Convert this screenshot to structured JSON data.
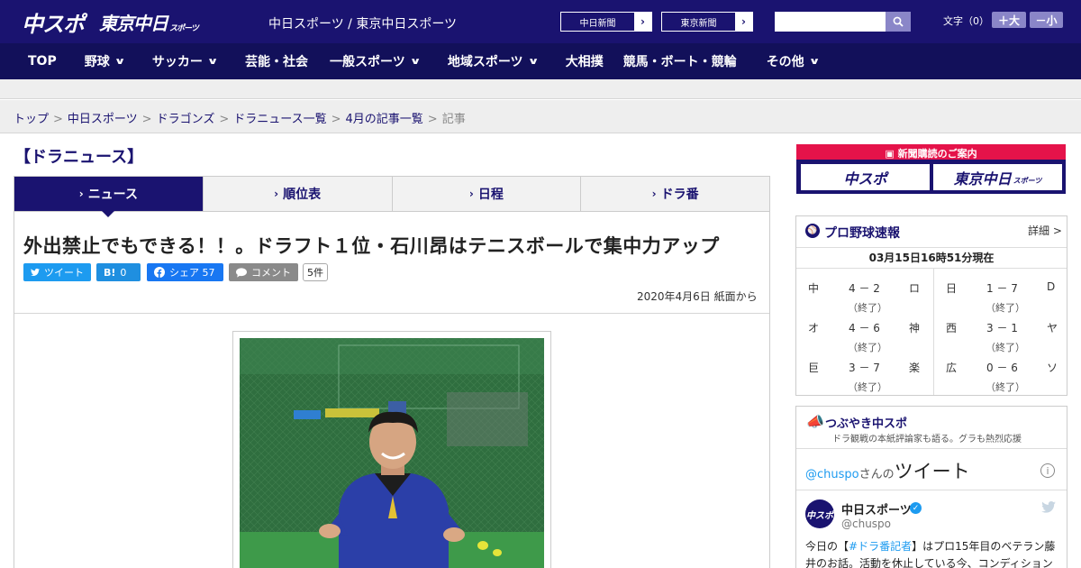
{
  "header": {
    "logo_chuspo": "中スポ",
    "logo_tokyo": "東京中日",
    "logo_tokyo_sub": "スポーツ",
    "site_title": "中日スポーツ / 東京中日スポーツ",
    "paper_links": [
      {
        "label": "中日新聞",
        "arrow": "›"
      },
      {
        "label": "東京新聞",
        "arrow": "›"
      }
    ],
    "search": {
      "placeholder": "",
      "icon": "search-icon"
    },
    "font_size_label": "文字（0）",
    "font_larger": "＋大",
    "font_smaller": "－小"
  },
  "nav": {
    "items": [
      {
        "label": "TOP",
        "dropdown": false
      },
      {
        "label": "野球",
        "dropdown": true
      },
      {
        "label": "サッカー",
        "dropdown": true
      },
      {
        "label": "芸能・社会",
        "dropdown": false
      },
      {
        "label": "一般スポーツ",
        "dropdown": true
      },
      {
        "label": "地域スポーツ",
        "dropdown": true
      },
      {
        "label": "大相撲",
        "dropdown": false
      },
      {
        "label": "競馬・ボート・競輪",
        "dropdown": false
      },
      {
        "label": "その他",
        "dropdown": true
      }
    ],
    "chevron": "∨"
  },
  "breadcrumb": {
    "items": [
      "トップ",
      "中日スポーツ",
      "ドラゴンズ",
      "ドラニュース一覧",
      "4月の記事一覧"
    ],
    "current": "記事",
    "separator": ">"
  },
  "section_title": "【ドラニュース】",
  "tabs": [
    {
      "label": "ニュース",
      "active": true
    },
    {
      "label": "順位表",
      "active": false
    },
    {
      "label": "日程",
      "active": false
    },
    {
      "label": "ドラ番",
      "active": false
    }
  ],
  "tab_chevron": "›",
  "article": {
    "headline": "外出禁止でもできる！！。ドラフト１位・石川昂はテニスボールで集中力アップ",
    "share": {
      "tweet": "ツイート",
      "hatena_icon": "B!",
      "hatena_count": "0",
      "facebook": "シェア",
      "facebook_count": "57",
      "comment": "コメント",
      "comment_count": "5件"
    },
    "dateline": "2020年4月6日 紙面から"
  },
  "sidebar": {
    "subscribe": {
      "title": "新聞購読のご案内",
      "logo_chuspo": "中スポ",
      "logo_tokyo": "東京中日",
      "logo_tokyo_sub": "スポーツ"
    },
    "baseball": {
      "title": "プロ野球速報",
      "detail": "詳細 >",
      "timestamp": "03月15日16時51分現在",
      "games": [
        {
          "home": "中",
          "score": "4 － 2",
          "away": "ロ",
          "status": "（終了）"
        },
        {
          "home": "日",
          "score": "1 － 7",
          "away": "D",
          "status": "（終了）"
        },
        {
          "home": "オ",
          "score": "4 － 6",
          "away": "神",
          "status": "（終了）"
        },
        {
          "home": "西",
          "score": "3 － 1",
          "away": "ヤ",
          "status": "（終了）"
        },
        {
          "home": "巨",
          "score": "3 － 7",
          "away": "楽",
          "status": "（終了）"
        },
        {
          "home": "広",
          "score": "0 － 6",
          "away": "ソ",
          "status": "（終了）"
        }
      ]
    },
    "tweets": {
      "title": "つぶやき中スポ",
      "subtitle": "ドラ観戦の本紙評論家も語る。グラも熱烈応援",
      "embed_handle_link": "@chuspo",
      "embed_suffix": "さんの",
      "embed_title": "ツイート",
      "info": "i",
      "avatar_text": "中スポ",
      "account_name": "中日スポーツ",
      "verified": "✓",
      "account_handle": "@chuspo",
      "tweet_pre": "今日の【",
      "tweet_hashtag": "#ドラ番記者",
      "tweet_post": "】はプロ15年目のベテラン藤井のお話。活動を休止している今、コンディション"
    }
  },
  "colors": {
    "brand_navy": "#1a1370",
    "nav_navy": "#12105a",
    "accent_red": "#e5134a",
    "twitter_blue": "#1d9bf0",
    "facebook_blue": "#1877f2"
  }
}
